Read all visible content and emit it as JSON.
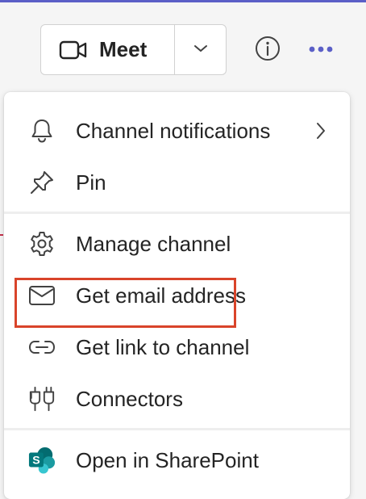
{
  "header": {
    "meet_label": "Meet",
    "meet_icon": "video-camera-icon",
    "dropdown_icon": "chevron-down-icon",
    "info_icon": "info-icon",
    "more_icon": "more-options-icon",
    "accent_color": "#5b5fc7"
  },
  "menu": {
    "items": [
      {
        "label": "Channel notifications",
        "icon": "bell-icon",
        "has_submenu": true
      },
      {
        "label": "Pin",
        "icon": "pin-icon"
      },
      {
        "label": "Manage channel",
        "icon": "gear-icon"
      },
      {
        "label": "Get email address",
        "icon": "envelope-icon"
      },
      {
        "label": "Get link to channel",
        "icon": "link-icon"
      },
      {
        "label": "Connectors",
        "icon": "plug-icon",
        "highlighted": true
      },
      {
        "label": "Open in SharePoint",
        "icon": "sharepoint-icon"
      }
    ],
    "highlight_color": "#d9442a",
    "sharepoint_colors": [
      "#036c70",
      "#1a9ba1",
      "#37c6d0"
    ]
  }
}
